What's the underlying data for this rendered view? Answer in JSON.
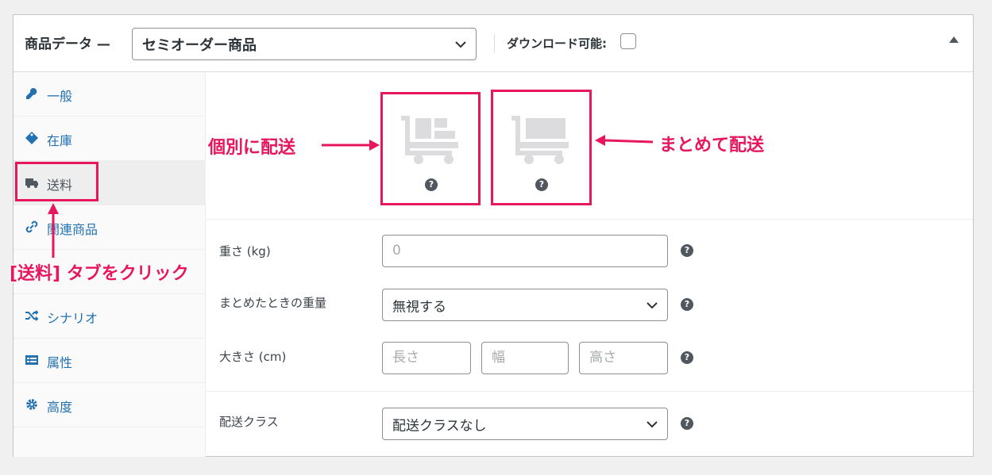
{
  "header": {
    "title": "商品データ —",
    "product_type": "セミオーダー商品",
    "downloadable_label": "ダウンロード可能:"
  },
  "tabs": [
    {
      "label": "一般",
      "icon": "wrench-icon"
    },
    {
      "label": "在庫",
      "icon": "tag-icon"
    },
    {
      "label": "送料",
      "icon": "truck-icon",
      "active": true
    },
    {
      "label": "関連商品",
      "icon": "link-icon"
    },
    {
      "label": "",
      "icon": "hidden"
    },
    {
      "label": "シナリオ",
      "icon": "shuffle-icon"
    },
    {
      "label": "属性",
      "icon": "list-icon"
    },
    {
      "label": "高度",
      "icon": "gear-icon"
    }
  ],
  "shipping": {
    "weight_label": "重さ (kg)",
    "weight_placeholder": "0",
    "combined_weight_label": "まとめたときの重量",
    "combined_weight_value": "無視する",
    "dimensions_label": "大きさ (cm)",
    "length_placeholder": "長さ",
    "width_placeholder": "幅",
    "height_placeholder": "高さ",
    "class_label": "配送クラス",
    "class_value": "配送クラスなし",
    "help_glyph": "?"
  },
  "annotations": {
    "individual": "個別に配送",
    "combined": "まとめて配送",
    "click_tab": "[送料] タブをクリック"
  },
  "colors": {
    "accent": "#e8175d",
    "link": "#2271b1"
  }
}
